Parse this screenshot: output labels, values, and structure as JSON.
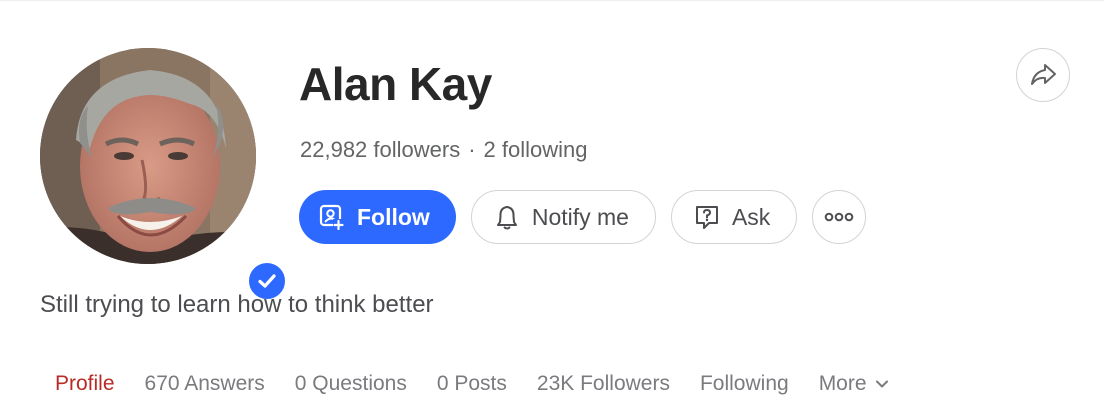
{
  "profile": {
    "name": "Alan Kay",
    "followers_text": "22,982 followers",
    "separator": "·",
    "following_text": "2 following",
    "bio": "Still trying to learn how to think better",
    "verified": true
  },
  "actions": {
    "follow_label": "Follow",
    "notify_label": "Notify me",
    "ask_label": "Ask"
  },
  "tabs": [
    {
      "label": "Profile",
      "active": true
    },
    {
      "label": "670 Answers",
      "active": false
    },
    {
      "label": "0 Questions",
      "active": false
    },
    {
      "label": "0 Posts",
      "active": false
    },
    {
      "label": "23K Followers",
      "active": false
    },
    {
      "label": "Following",
      "active": false
    },
    {
      "label": "More",
      "active": false
    }
  ],
  "icons": {
    "follow": "person-add-icon",
    "notify": "bell-icon",
    "ask": "question-bubble-icon",
    "more": "more-horizontal-icon",
    "share": "share-arrow-icon",
    "verified": "checkmark-badge-icon",
    "more_tab": "chevron-down-icon"
  },
  "colors": {
    "primary": "#2e69ff",
    "active_tab": "#b92b27",
    "text": "#282829",
    "muted": "#636466"
  }
}
